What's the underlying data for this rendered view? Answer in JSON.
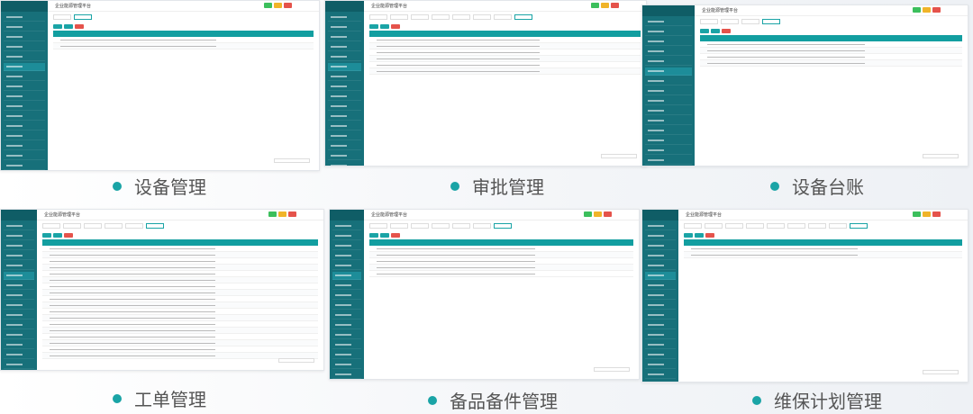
{
  "app_title": "企业能源管理平台",
  "accent": "#1aa4a6",
  "panels": [
    {
      "caption": "设备管理",
      "rows": 2,
      "tabs": 2
    },
    {
      "caption": "审批管理",
      "rows": 6,
      "tabs": 8
    },
    {
      "caption": "设备台账",
      "rows": 4,
      "tabs": 4
    },
    {
      "caption": "工单管理",
      "rows": 18,
      "tabs": 6
    },
    {
      "caption": "备品备件管理",
      "rows": 5,
      "tabs": 7
    },
    {
      "caption": "维保计划管理",
      "rows": 2,
      "tabs": 9
    }
  ]
}
